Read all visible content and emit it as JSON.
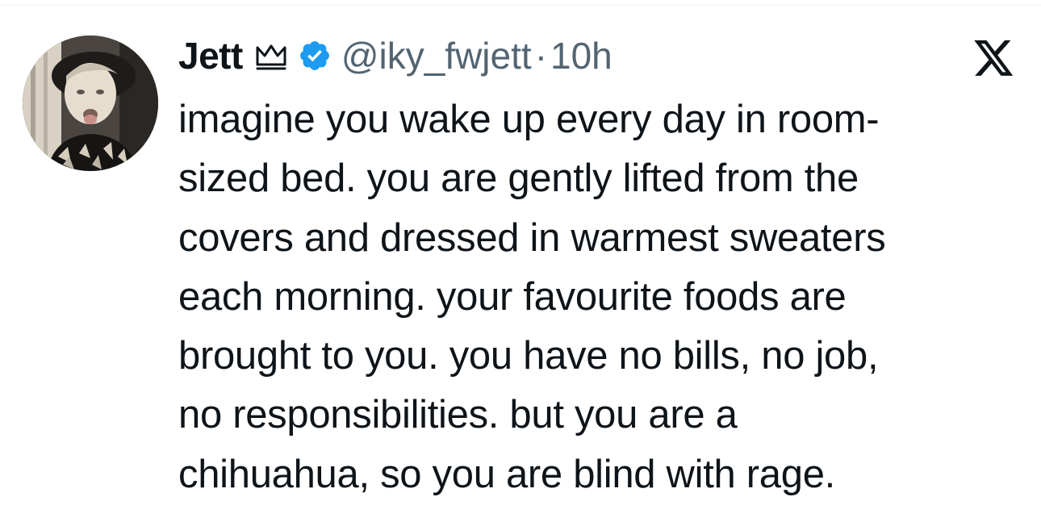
{
  "author": {
    "display_name": "Jett",
    "handle": "@iky_fwjett",
    "separator": "·",
    "time": "10h",
    "verified_color": "#1d9bf0",
    "badge_icons": [
      "crown-icon",
      "verified-icon"
    ]
  },
  "platform": {
    "logo": "x-logo-icon"
  },
  "tweet": {
    "lines": [
      "imagine you wake up every day in room-",
      "sized bed. you are gently lifted from the",
      "covers and dressed in warmest sweaters",
      "each morning. your favourite foods are",
      "brought to you. you have no bills, no job,",
      "no responsibilities. but you are a",
      "chihuahua, so you are blind with rage."
    ]
  },
  "colors": {
    "text": "#0f1419",
    "secondary": "#536471",
    "verified": "#1d9bf0"
  }
}
